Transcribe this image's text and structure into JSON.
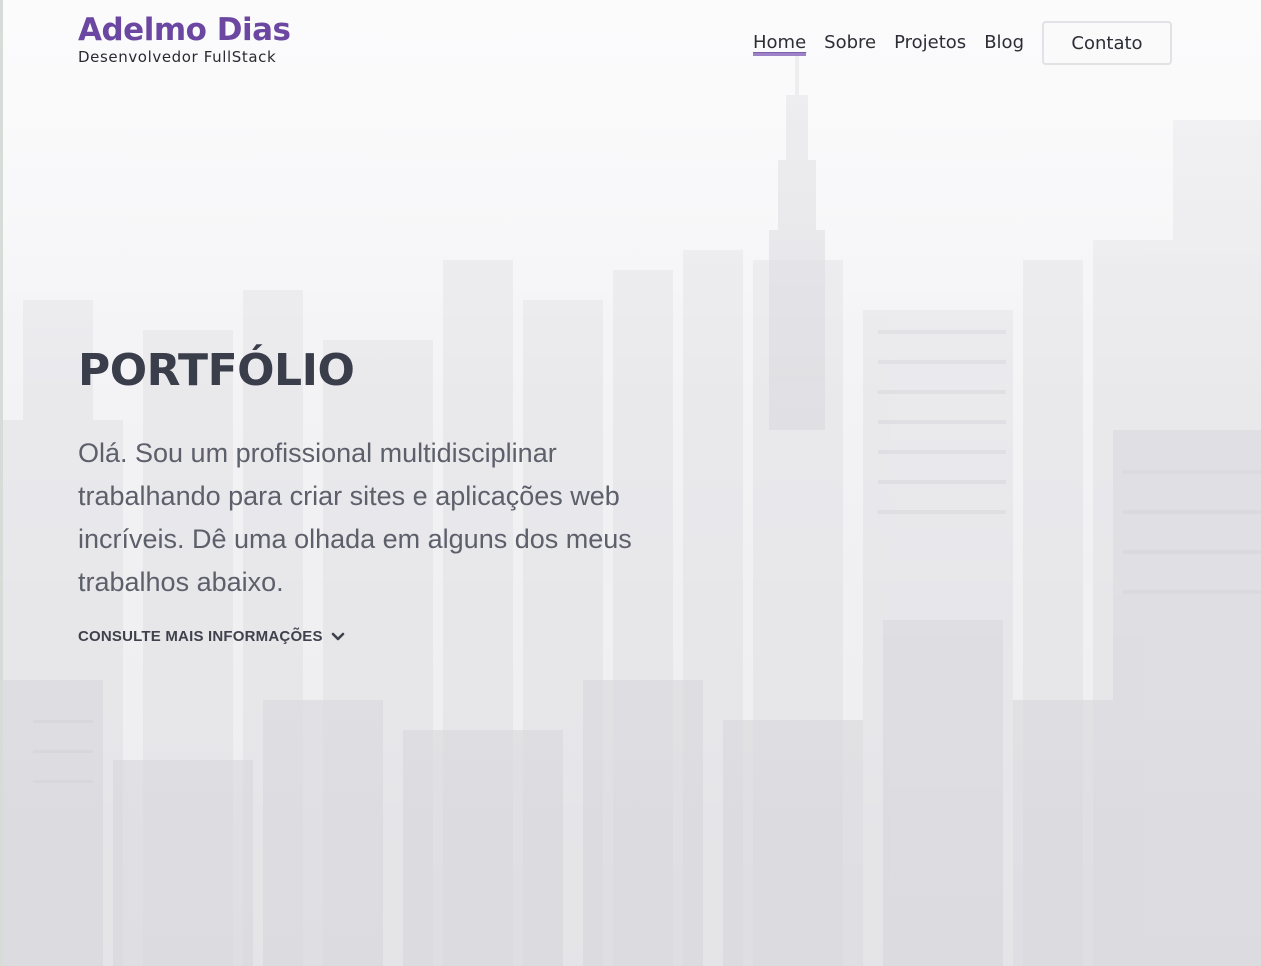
{
  "brand": {
    "name": "Adelmo Dias",
    "subtitle": "Desenvolvedor FullStack"
  },
  "nav": {
    "items": [
      {
        "label": "Home",
        "active": true
      },
      {
        "label": "Sobre"
      },
      {
        "label": "Projetos"
      },
      {
        "label": "Blog"
      }
    ],
    "contact_label": "Contato"
  },
  "hero": {
    "title": "PORTFÓLIO",
    "intro": "Olá. Sou um profissional multidisciplinar trabalhando para criar sites e aplicações web incríveis. Dê uma olhada em alguns dos meus trabalhos abaixo.",
    "more_label": "CONSULTE MAIS INFORMAÇÕES",
    "more_icon": "chevron-down-icon"
  },
  "colors": {
    "accent": "#6b47a1",
    "underline": "#8d6cc0",
    "text": "#2d2d36"
  }
}
